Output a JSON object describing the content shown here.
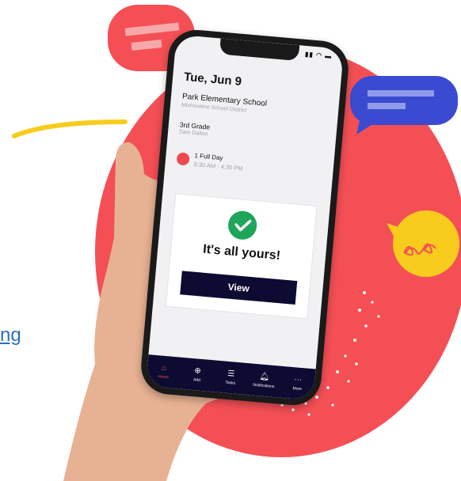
{
  "link_text": "ng",
  "phone": {
    "date": "Tue, Jun 9",
    "school": "Park Elementary School",
    "district": "Mishoreline School District",
    "grade": "3rd Grade",
    "teacher": "Sam Dalton",
    "day_type": "1 Full Day",
    "day_time": "8:30 AM - 4:30 PM",
    "card_title": "It's all yours!",
    "view_label": "View",
    "tabs": [
      {
        "label": "Home",
        "icon": "home-icon"
      },
      {
        "label": "Add",
        "icon": "add-icon"
      },
      {
        "label": "Tasks",
        "icon": "tasks-icon"
      },
      {
        "label": "Notifications",
        "icon": "bell-icon"
      },
      {
        "label": "More",
        "icon": "more-icon"
      }
    ]
  },
  "colors": {
    "blob": "#f44f55",
    "bubble_red": "#f44f55",
    "bubble_blue": "#3a4bd1",
    "bubble_yellow": "#f7cc1d",
    "navy": "#0d0b32",
    "check_green": "#1fa55a",
    "link": "#2d6fb6"
  }
}
